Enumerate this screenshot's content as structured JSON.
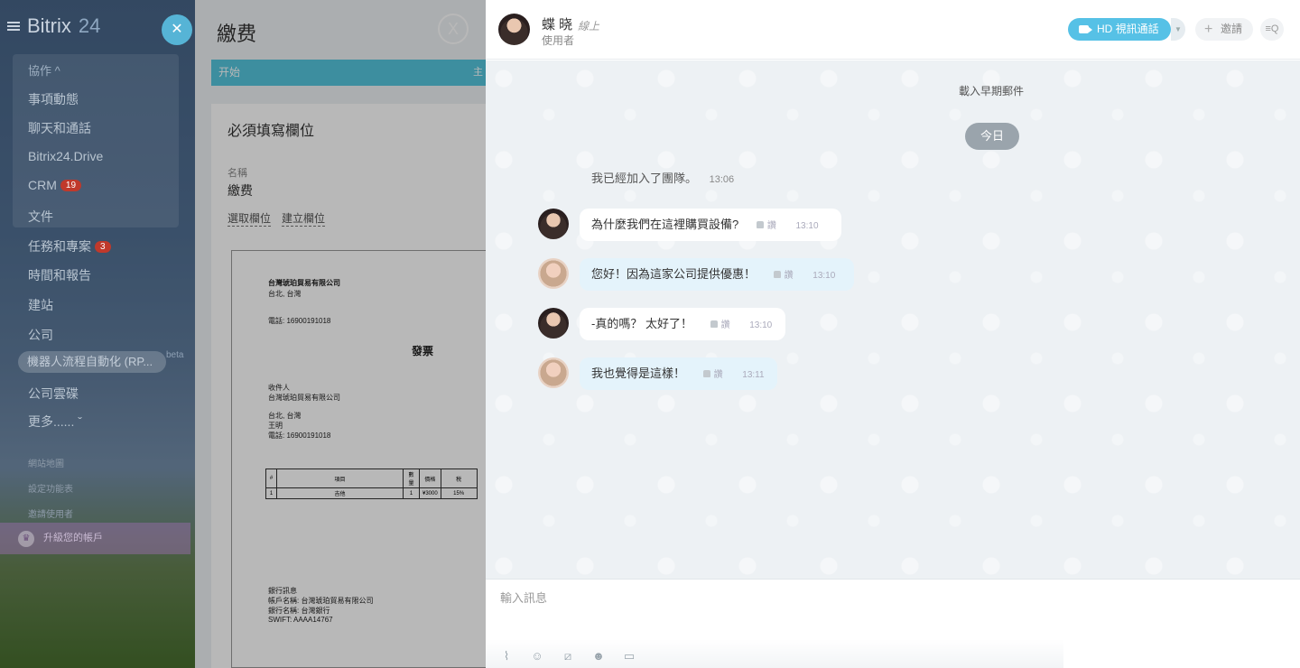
{
  "sidebar": {
    "logo": "Bitrix",
    "logo_num": "24",
    "close_label": "✕",
    "group_head": "協作 ^",
    "items": [
      {
        "label": "事項動態",
        "badge": ""
      },
      {
        "label": "聊天和通話",
        "badge": ""
      },
      {
        "label": "Bitrix24.Drive",
        "badge": ""
      },
      {
        "label": "CRM",
        "badge": "19"
      },
      {
        "label": "文件",
        "badge": ""
      },
      {
        "label": "任務和專案",
        "badge": "3"
      },
      {
        "label": "時間和報告",
        "badge": ""
      },
      {
        "label": "建站",
        "badge": ""
      },
      {
        "label": "公司",
        "badge": ""
      }
    ],
    "pill_label": "機器人流程自動化 (RP...",
    "beta": "beta",
    "after_pill": [
      "公司雲碟",
      "更多...... ˇ"
    ],
    "small_links": [
      "網站地圖",
      "設定功能表",
      "邀請使用者"
    ],
    "upgrade": "升級您的帳戶",
    "colors": {
      "accent": "#56b4d6",
      "badge": "#c0392b",
      "upgrade": "#a06eb4"
    }
  },
  "invoice": {
    "title": "繳费",
    "close": "X",
    "stage_start": "开始",
    "stage_next": "主",
    "card_heading": "必須填寫欄位",
    "field_label": "名稱",
    "field_value": "繳费",
    "link_select": "選取欄位",
    "link_create": "建立欄位",
    "doc": {
      "company": "台灣琥珀貿易有限公司",
      "city": "台北, 台灣",
      "phone": "電話: 16900191018",
      "heading": "發票",
      "recipient_label": "收件人",
      "recipient": "台灣琥珀貿易有限公司",
      "rcity": "台北, 台灣",
      "person": "王明",
      "rphone": "電話: 16900191018",
      "table_headers": [
        "#",
        "項目",
        "數量",
        "價格",
        "税"
      ],
      "table_row": [
        "1",
        "吉他",
        "1",
        "¥3000",
        "15%"
      ],
      "bank_label": "銀行訊息",
      "bank_acct": "帳戶名稱: 台灣琥珀貿易有限公司",
      "bank_name": "銀行名稱: 台灣銀行",
      "swift": "SWIFT: AAAA14767"
    }
  },
  "chat": {
    "name": "蝶 晓",
    "status": "線上",
    "role": "使用者",
    "hd_call": "HD 視訊通話",
    "invite": "邀請",
    "search_icon_text": "≡Q",
    "load_more": "載入早期郵件",
    "today": "今日",
    "system_message": {
      "text": "我已經加入了團隊。",
      "time": "13:06"
    },
    "messages": [
      {
        "text": "為什麼我們在這裡購買設備?",
        "like": "讚",
        "time": "13:10",
        "style": "white",
        "avatar": "a"
      },
      {
        "text": "您好！因為這家公司提供優惠！",
        "like": "讚",
        "time": "13:10",
        "style": "blue",
        "avatar": "b"
      },
      {
        "text": "-真的嗎？ 太好了！",
        "like": "讚",
        "time": "13:10",
        "style": "white",
        "avatar": "a"
      },
      {
        "text": "我也覺得是這樣！",
        "like": "讚",
        "time": "13:11",
        "style": "blue",
        "avatar": "b"
      }
    ],
    "input_placeholder": "輸入訊息",
    "tool_icons": [
      "paperclip-icon",
      "user-icon",
      "slash-icon",
      "smile-icon",
      "screen-icon"
    ],
    "colors": {
      "hd_button": "#56c1e6",
      "bubble_blue": "#e4f3fb",
      "today_pill": "#9aa4ac"
    }
  }
}
